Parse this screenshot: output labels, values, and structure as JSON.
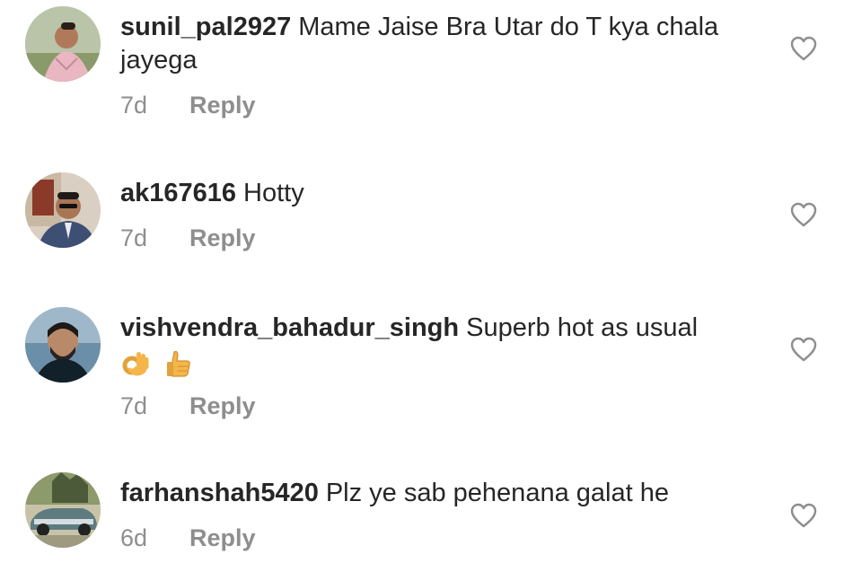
{
  "comments": [
    {
      "username": "sunil_pal2927",
      "text": "Mame Jaise Bra Utar do T kya chala jayega",
      "time": "7d",
      "reply_label": "Reply",
      "emojis": []
    },
    {
      "username": "ak167616",
      "text": "Hotty",
      "time": "7d",
      "reply_label": "Reply",
      "emojis": []
    },
    {
      "username": "vishvendra_bahadur_singh",
      "text": "Superb hot as usual",
      "time": "7d",
      "reply_label": "Reply",
      "emojis": [
        "ok-hand-emoji",
        "thumbs-up-emoji"
      ]
    },
    {
      "username": "farhanshah5420",
      "text": "Plz ye sab pehenana galat he",
      "time": "6d",
      "reply_label": "Reply",
      "emojis": []
    }
  ],
  "icons": {
    "like": "heart-outline-icon"
  },
  "colors": {
    "text": "#262626",
    "secondary": "#8e8e8e"
  }
}
